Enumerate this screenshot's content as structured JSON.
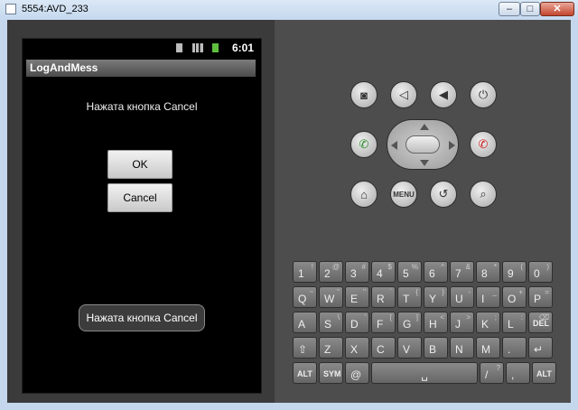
{
  "window": {
    "title": "5554:AVD_233",
    "minimize": "–",
    "maximize": "□",
    "close": "✕"
  },
  "status_bar": {
    "time": "6:01",
    "icons": [
      "sim-icon",
      "signal-icon",
      "battery-icon"
    ]
  },
  "app": {
    "title": "LogAndMess",
    "message": "Нажата кнопка Cancel",
    "ok_label": "OK",
    "cancel_label": "Cancel",
    "toast": "Нажата кнопка Cancel"
  },
  "controls": {
    "menu_label": "MENU",
    "icons": [
      "camera-icon",
      "volume-down-icon",
      "volume-up-icon",
      "power-icon",
      "call-icon",
      "end-call-icon",
      "home-icon",
      "back-icon",
      "search-icon"
    ]
  },
  "keyboard": {
    "row1": [
      [
        "1",
        "!"
      ],
      [
        "2",
        "@"
      ],
      [
        "3",
        "#"
      ],
      [
        "4",
        "$"
      ],
      [
        "5",
        "%"
      ],
      [
        "6",
        "^"
      ],
      [
        "7",
        "&"
      ],
      [
        "8",
        "*"
      ],
      [
        "9",
        "("
      ],
      [
        "0",
        ")"
      ]
    ],
    "row2": [
      [
        "Q",
        "~"
      ],
      [
        "W",
        "\""
      ],
      [
        "E",
        "\""
      ],
      [
        "R",
        "`"
      ],
      [
        "T",
        "{"
      ],
      [
        "Y",
        "}"
      ],
      [
        "U",
        "-"
      ],
      [
        "I",
        "_"
      ],
      [
        "O",
        "+"
      ],
      [
        "P",
        "="
      ]
    ],
    "row3": [
      [
        "A",
        ""
      ],
      [
        "S",
        "\\"
      ],
      [
        "D",
        "'"
      ],
      [
        "F",
        "["
      ],
      [
        "G",
        "]"
      ],
      [
        "H",
        "<"
      ],
      [
        "J",
        ">"
      ],
      [
        "K",
        ";"
      ],
      [
        "L",
        ":"
      ],
      [
        "DEL",
        "⌫"
      ]
    ],
    "row4": [
      [
        "⇧",
        ""
      ],
      [
        "Z",
        ""
      ],
      [
        "X",
        ""
      ],
      [
        "C",
        ""
      ],
      [
        "V",
        ""
      ],
      [
        "B",
        ""
      ],
      [
        "N",
        ""
      ],
      [
        "M",
        ""
      ],
      [
        ".",
        ""
      ],
      [
        "↵",
        ""
      ]
    ],
    "row5": [
      [
        "ALT",
        ""
      ],
      [
        "SYM",
        ""
      ],
      [
        "@",
        ""
      ],
      [
        "␣",
        ""
      ],
      [
        "/",
        "?"
      ],
      [
        ",",
        ""
      ],
      [
        "ALT",
        ""
      ]
    ]
  }
}
